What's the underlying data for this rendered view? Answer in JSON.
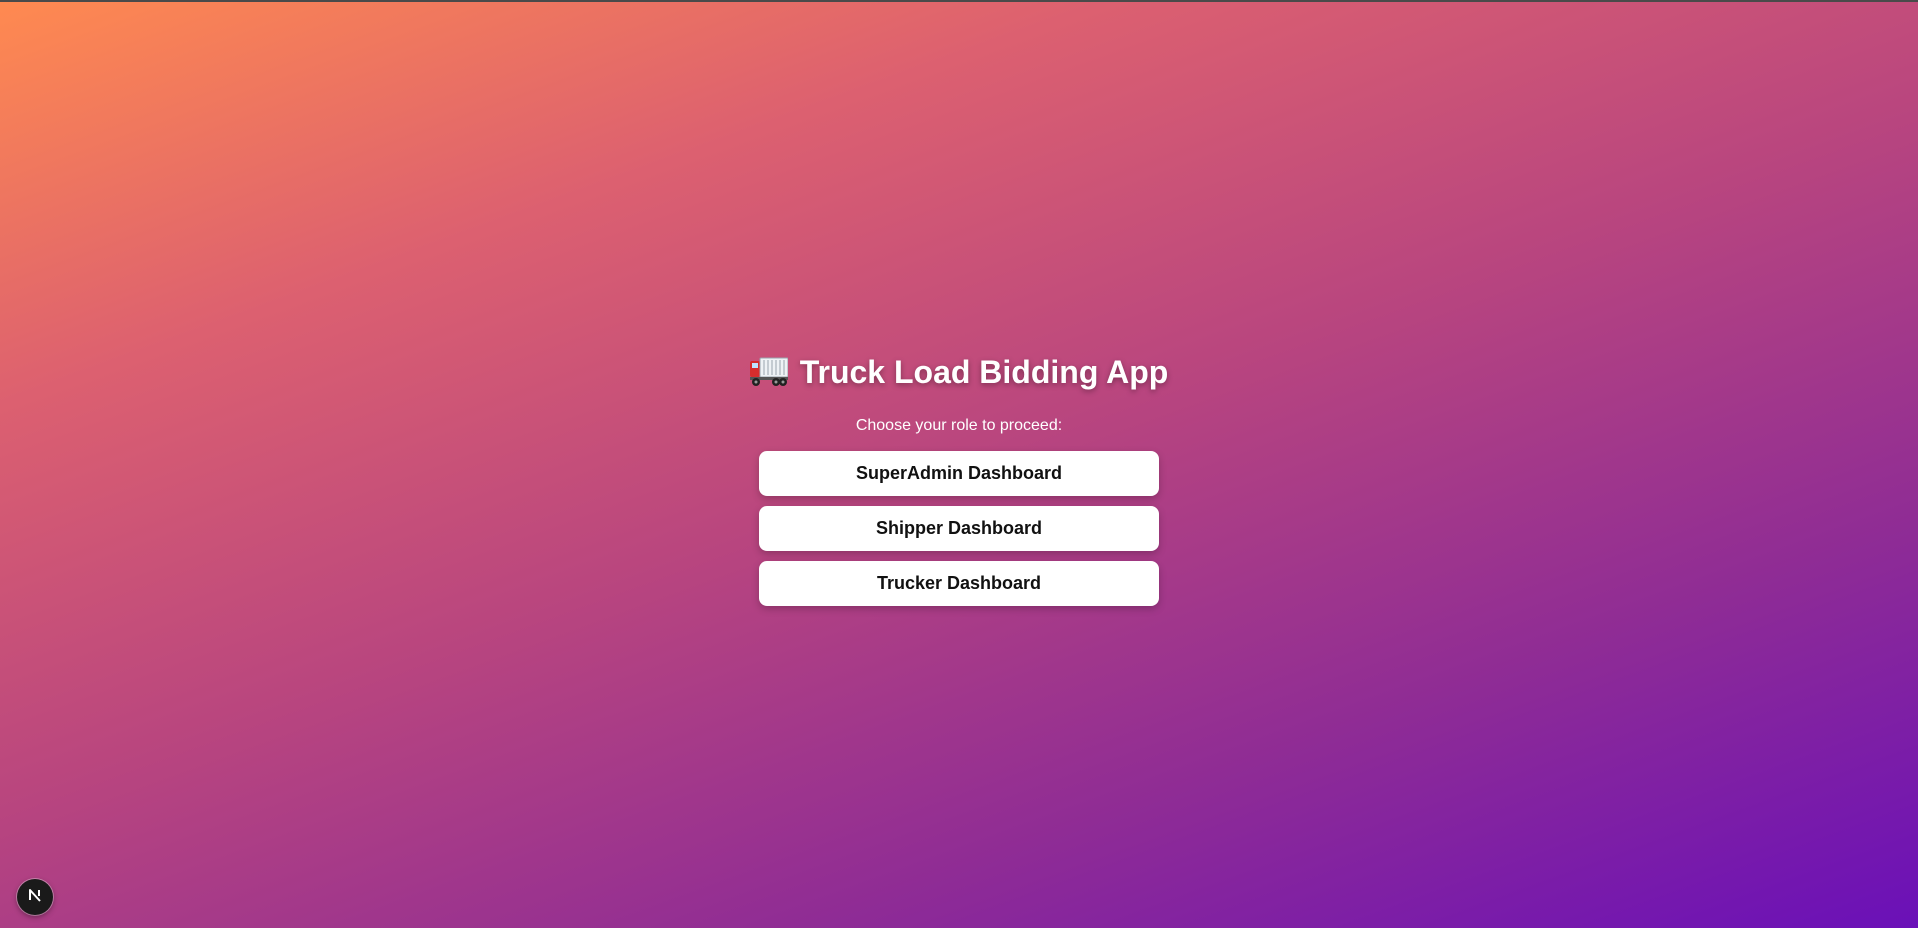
{
  "app": {
    "title": "Truck Load Bidding App",
    "title_icon": "truck-icon",
    "subtitle": "Choose your role to proceed:"
  },
  "roles": {
    "superadmin_label": "SuperAdmin Dashboard",
    "shipper_label": "Shipper Dashboard",
    "trucker_label": "Trucker Dashboard"
  },
  "dev_badge": {
    "icon": "nextjs-logo-icon"
  },
  "colors": {
    "gradient_start": "#ff8a50",
    "gradient_end": "#6a10b8",
    "button_bg": "#ffffff",
    "button_text": "#111111"
  }
}
